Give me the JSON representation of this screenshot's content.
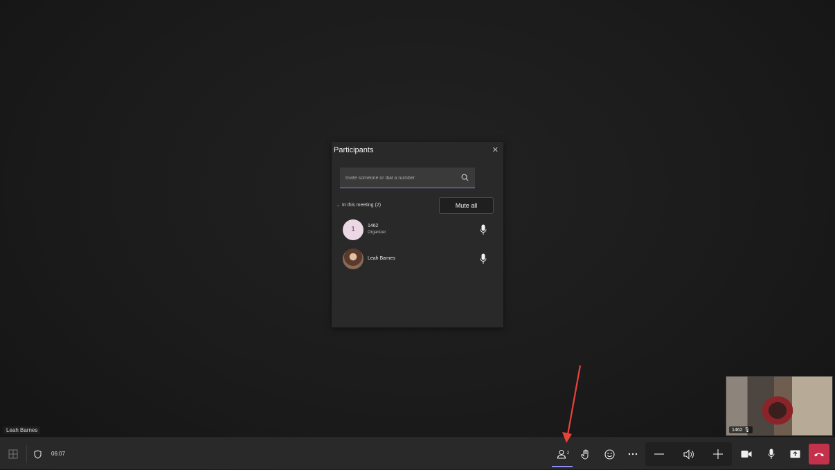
{
  "stage": {
    "speaker_name": "Leah Barnes"
  },
  "panel": {
    "title": "Participants",
    "search_placeholder": "Invite someone or dial a number",
    "section_label": "In this meeting (2)",
    "mute_all_label": "Mute all",
    "participants": [
      {
        "name": "1462",
        "role": "Organizer",
        "avatar_initial": "1",
        "avatar_color": "#ecd8e4"
      },
      {
        "name": "Leah Barnes",
        "role": ""
      }
    ]
  },
  "self_video": {
    "label": "1462"
  },
  "toolbar": {
    "timer": "06:07",
    "participants_count": "2",
    "icons": [
      "grid-icon",
      "shield-icon",
      "participants-icon",
      "raise-hand-icon",
      "reactions-icon",
      "more-icon",
      "volume-down-icon",
      "speaker-icon",
      "volume-up-icon",
      "camera-icon",
      "mic-icon",
      "share-icon",
      "leave-icon"
    ]
  },
  "colors": {
    "accent": "#8d8df0",
    "leave": "#c4314b",
    "annotation_arrow": "#e8423a"
  }
}
